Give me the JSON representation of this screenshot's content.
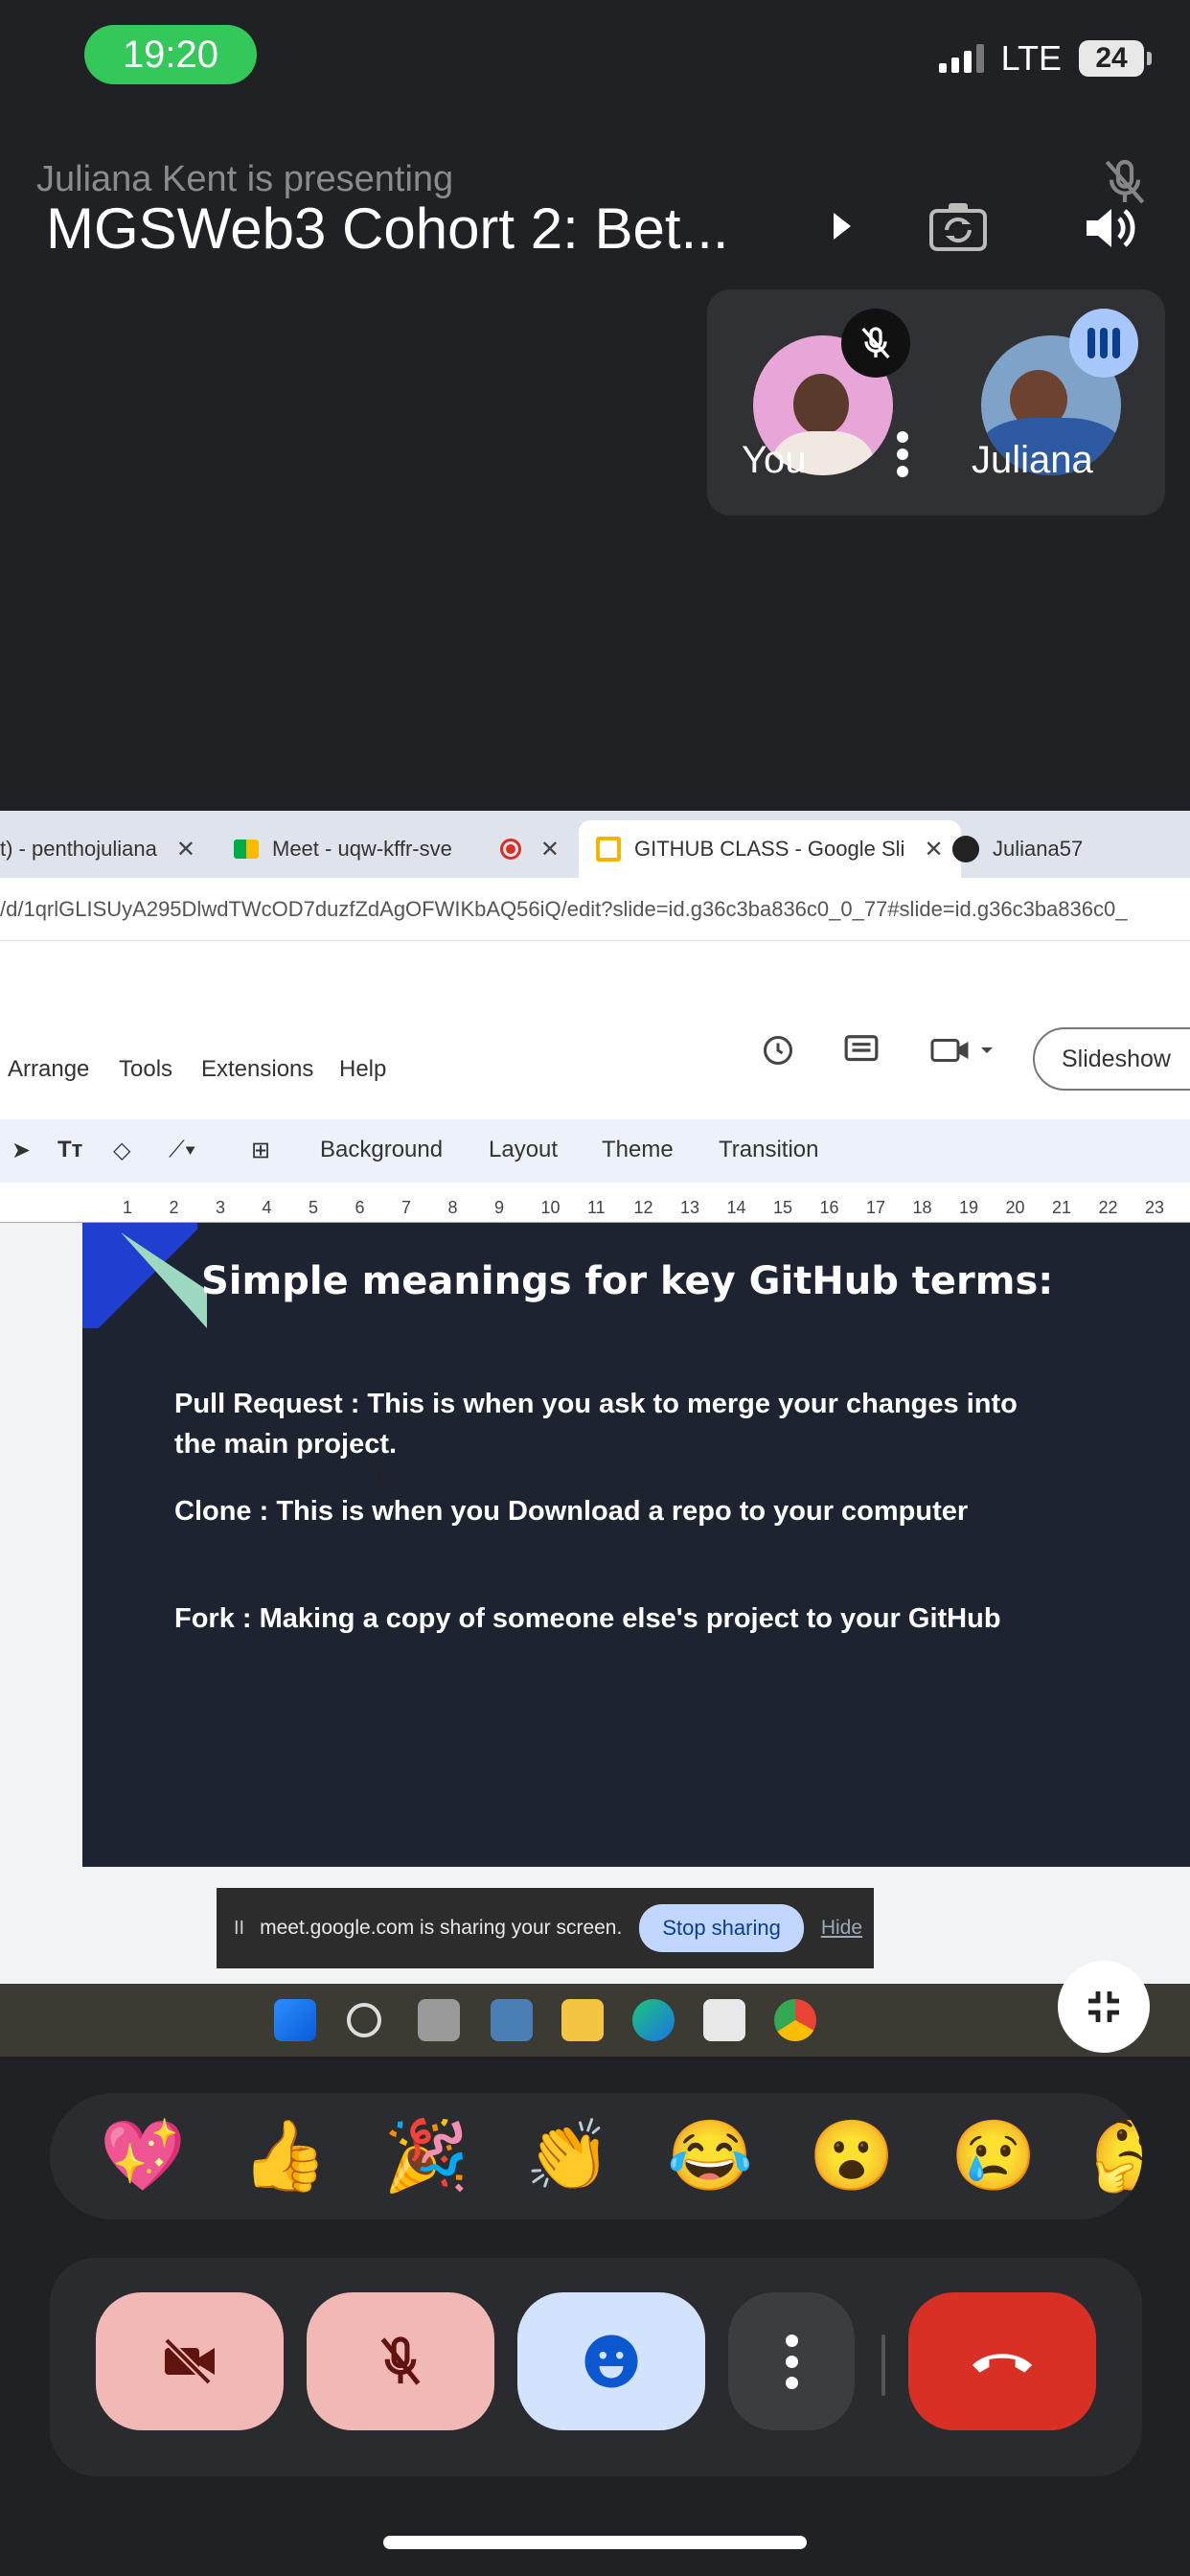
{
  "status": {
    "time": "19:20",
    "network": "LTE",
    "battery": "24"
  },
  "header": {
    "presenting_text": "Juliana Kent is presenting",
    "meeting_title": "MGSWeb3 Cohort 2: Bet..."
  },
  "participants": [
    {
      "name": "You",
      "muted": true
    },
    {
      "name": "Juliana",
      "speaking": true
    }
  ],
  "shared_screen": {
    "tabs": [
      {
        "label": "t) - penthojuliana",
        "close": "✕"
      },
      {
        "label": "Meet - uqw-kffr-sve"
      },
      {
        "label": "GITHUB CLASS - Google Sli",
        "close": "✕",
        "active": true
      },
      {
        "label": "Juliana57"
      }
    ],
    "url": "/d/1qrlGLISUyA295DlwdTWcOD7duzfZdAgOFWIKbAQ56iQ/edit?slide=id.g36c3ba836c0_0_77#slide=id.g36c3ba836c0_",
    "menu": [
      "Arrange",
      "Tools",
      "Extensions",
      "Help"
    ],
    "slideshow_label": "Slideshow",
    "toolbar": [
      "Background",
      "Layout",
      "Theme",
      "Transition"
    ],
    "ruler_ticks": [
      "1",
      "2",
      "3",
      "4",
      "5",
      "6",
      "7",
      "8",
      "9",
      "10",
      "11",
      "12",
      "13",
      "14",
      "15",
      "16",
      "17",
      "18",
      "19",
      "20",
      "21",
      "22",
      "23"
    ],
    "slide": {
      "title": "Simple meanings for key GitHub terms:",
      "lines": [
        "Pull Request :  This is when you ask to merge your changes into the main project.",
        "Clone : This is when you  Download a repo to your computer",
        "Fork :  Making a copy of someone else's project to your GitHub"
      ]
    },
    "share_bar": {
      "pause": "II",
      "text": "meet.google.com is sharing your screen.",
      "stop": "Stop sharing",
      "hide": "Hide"
    }
  },
  "reactions": [
    "💖",
    "👍",
    "🎉",
    "👏",
    "😂",
    "😮",
    "😢",
    "🤔"
  ],
  "colors": {
    "end_call": "#d93025",
    "muted_bg": "#f2b8b5",
    "emoji_bg": "#d3e3fd"
  }
}
